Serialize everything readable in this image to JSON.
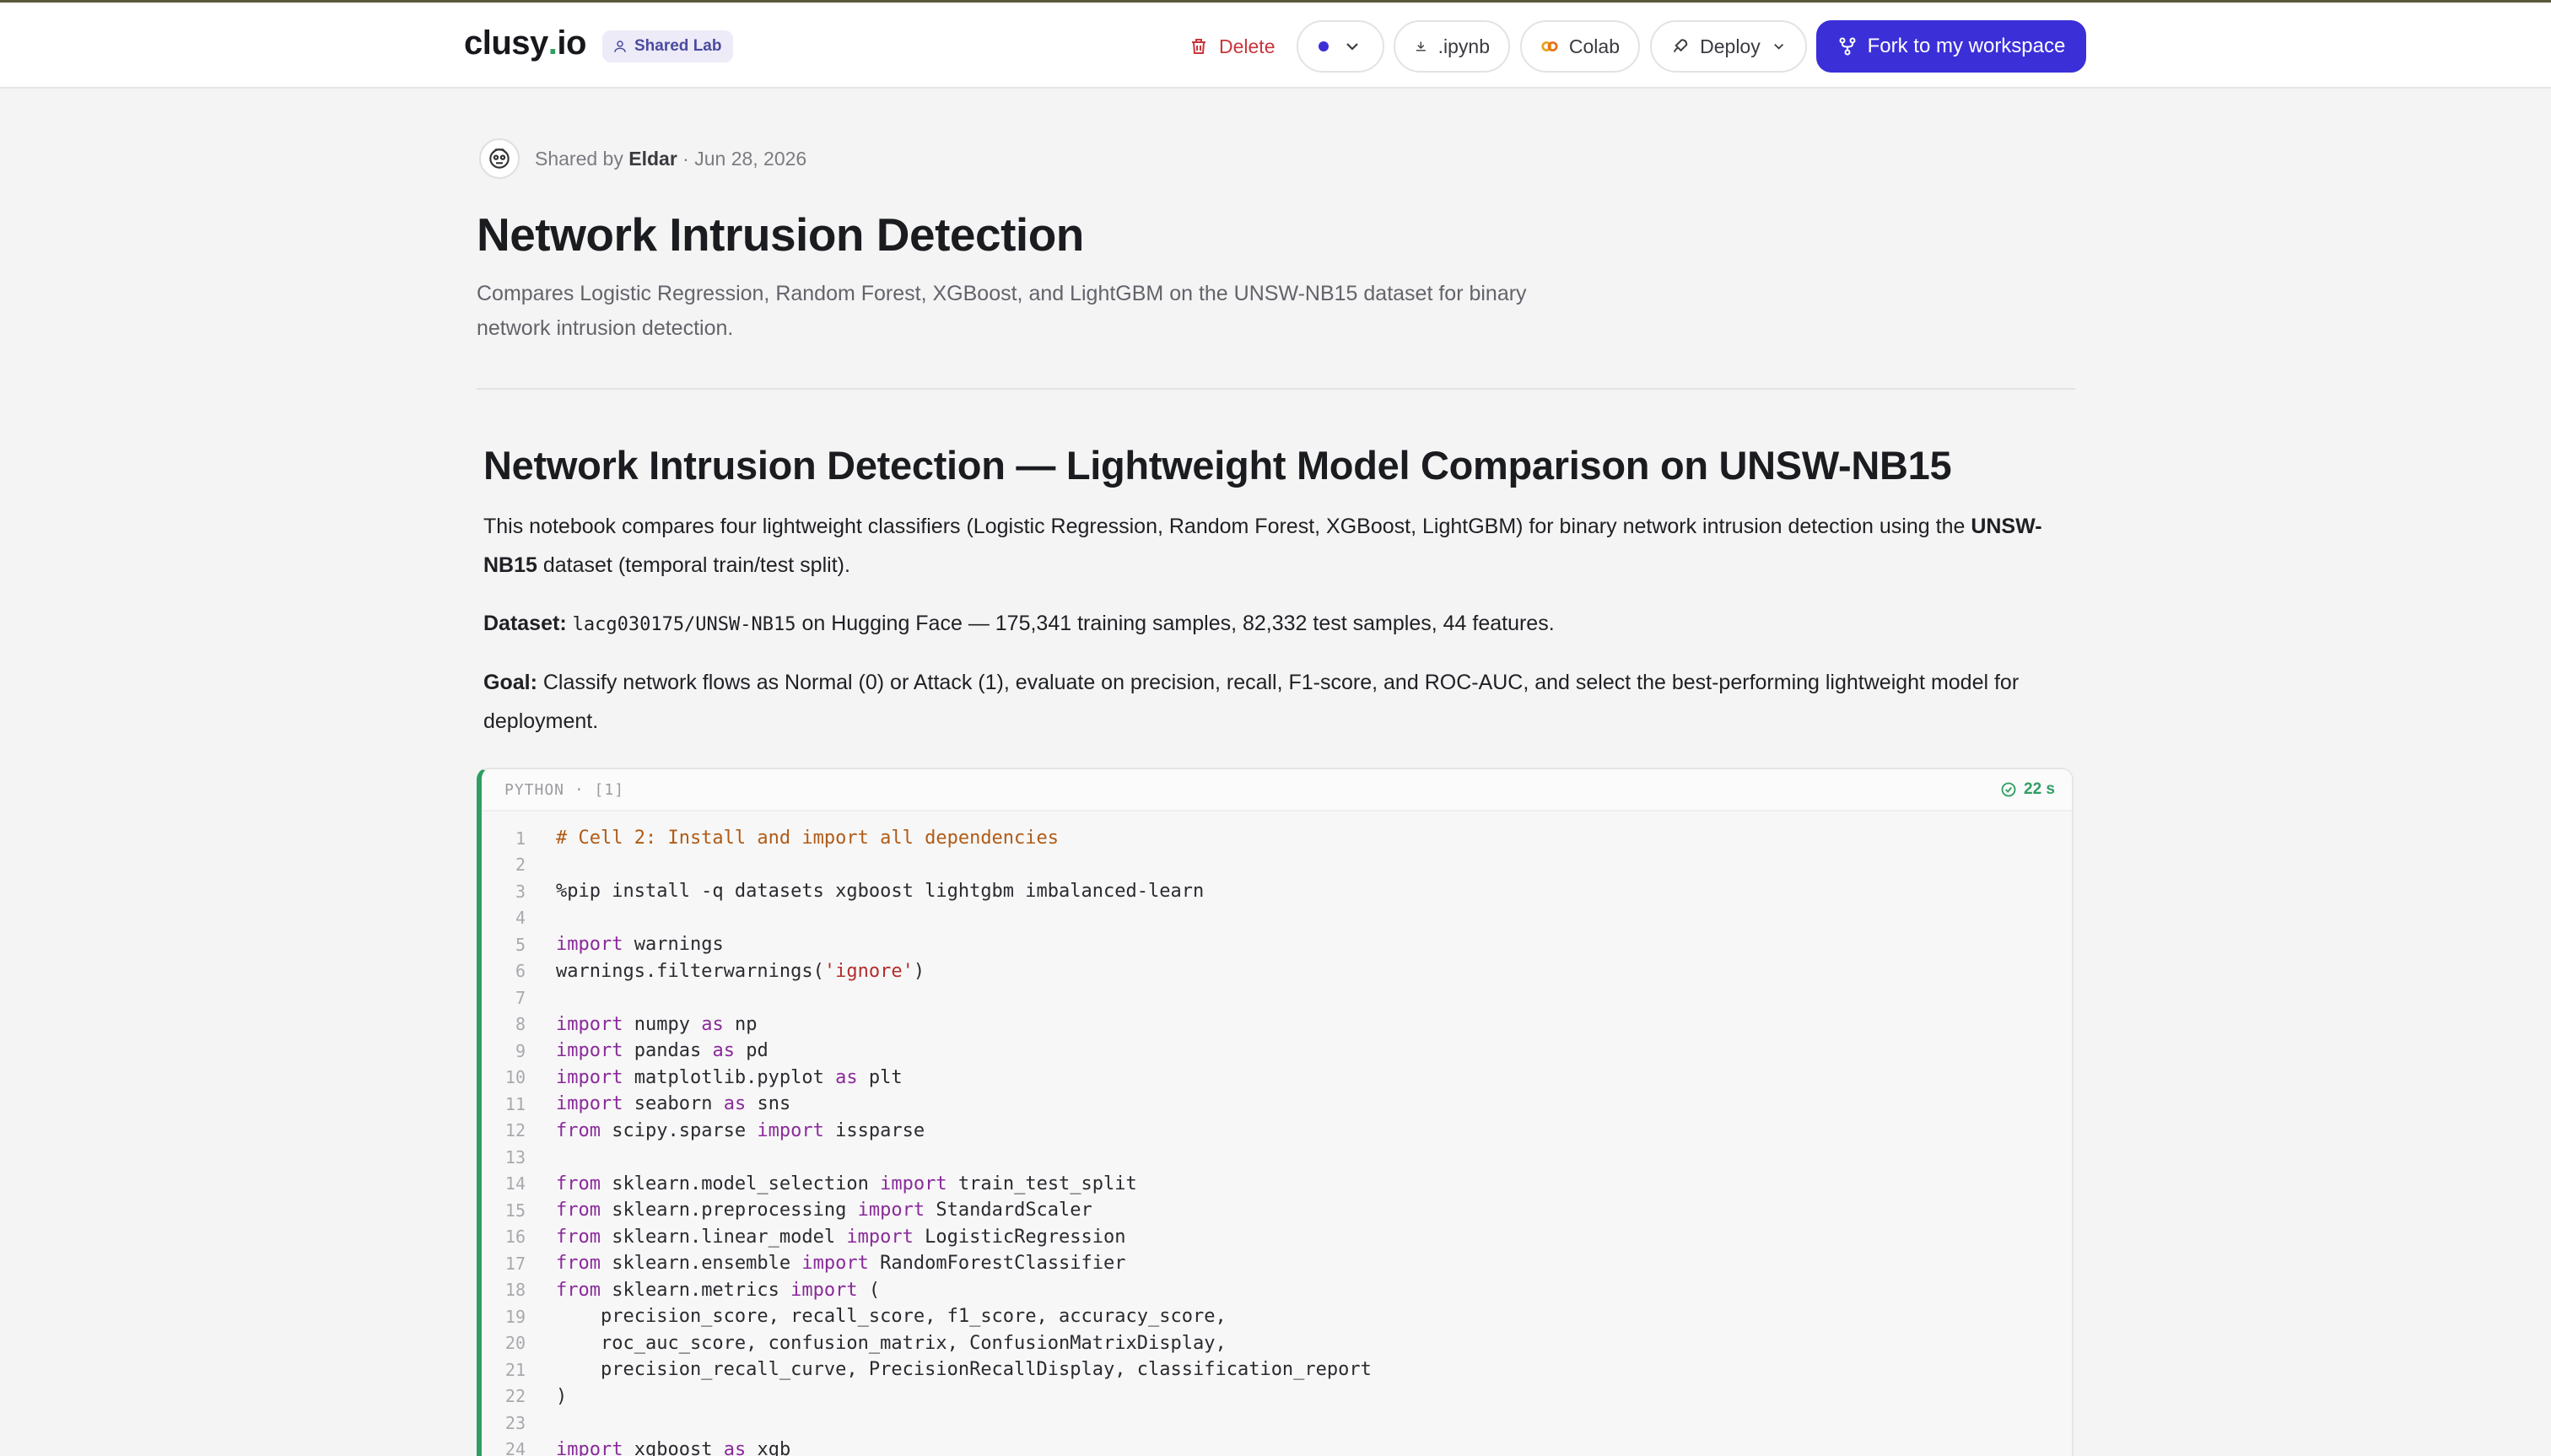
{
  "header": {
    "logo_main": "clusy",
    "logo_dot": ".",
    "logo_tld": "io",
    "shared_badge": "Shared Lab",
    "delete_label": "Delete",
    "ipynb_label": ".ipynb",
    "colab_label": "Colab",
    "deploy_label": "Deploy",
    "fork_label": "Fork to my workspace"
  },
  "meta": {
    "shared_by_prefix": "Shared by",
    "author": "Eldar",
    "date": "· Jun 28, 2026"
  },
  "page": {
    "title": "Network Intrusion Detection",
    "description": "Compares Logistic Regression, Random Forest, XGBoost, and LightGBM on the UNSW-NB15 dataset for binary network intrusion detection."
  },
  "notebook": {
    "heading": "Network Intrusion Detection — Lightweight Model Comparison on UNSW-NB15",
    "p1_text": "This notebook compares four lightweight classifiers (Logistic Regression, Random Forest, XGBoost, LightGBM) for binary network intrusion detection using the ",
    "p1_bold": "UNSW-NB15",
    "p1_tail": " dataset (temporal train/test split).",
    "p2_label": "Dataset:",
    "p2_code": "lacg030175/UNSW-NB15",
    "p2_text": " on Hugging Face — 175,341 training samples, 82,332 test samples, 44 features.",
    "p3_label": "Goal:",
    "p3_text": " Classify network flows as Normal (0) or Attack (1), evaluate on precision, recall, F1-score, and ROC-AUC, and select the best-performing lightweight model for deployment."
  },
  "cell": {
    "label": "PYTHON · [1]",
    "runtime": "22 s",
    "lines": [
      [
        [
          "com",
          "# Cell 2: Install and import all dependencies"
        ]
      ],
      [],
      [
        [
          "",
          "%pip install -q datasets xgboost lightgbm imbalanced-learn"
        ]
      ],
      [],
      [
        [
          "kw",
          "import"
        ],
        [
          "",
          " warnings"
        ]
      ],
      [
        [
          "",
          "warnings.filterwarnings("
        ],
        [
          "str",
          "'ignore'"
        ],
        [
          "",
          ")"
        ]
      ],
      [],
      [
        [
          "kw",
          "import"
        ],
        [
          "",
          " numpy "
        ],
        [
          "kw",
          "as"
        ],
        [
          "",
          " np"
        ]
      ],
      [
        [
          "kw",
          "import"
        ],
        [
          "",
          " pandas "
        ],
        [
          "kw",
          "as"
        ],
        [
          "",
          " pd"
        ]
      ],
      [
        [
          "kw",
          "import"
        ],
        [
          "",
          " matplotlib.pyplot "
        ],
        [
          "kw",
          "as"
        ],
        [
          "",
          " plt"
        ]
      ],
      [
        [
          "kw",
          "import"
        ],
        [
          "",
          " seaborn "
        ],
        [
          "kw",
          "as"
        ],
        [
          "",
          " sns"
        ]
      ],
      [
        [
          "kw",
          "from"
        ],
        [
          "",
          " scipy.sparse "
        ],
        [
          "kw",
          "import"
        ],
        [
          "",
          " issparse"
        ]
      ],
      [],
      [
        [
          "kw",
          "from"
        ],
        [
          "",
          " sklearn.model_selection "
        ],
        [
          "kw",
          "import"
        ],
        [
          "",
          " train_test_split"
        ]
      ],
      [
        [
          "kw",
          "from"
        ],
        [
          "",
          " sklearn.preprocessing "
        ],
        [
          "kw",
          "import"
        ],
        [
          "",
          " StandardScaler"
        ]
      ],
      [
        [
          "kw",
          "from"
        ],
        [
          "",
          " sklearn.linear_model "
        ],
        [
          "kw",
          "import"
        ],
        [
          "",
          " LogisticRegression"
        ]
      ],
      [
        [
          "kw",
          "from"
        ],
        [
          "",
          " sklearn.ensemble "
        ],
        [
          "kw",
          "import"
        ],
        [
          "",
          " RandomForestClassifier"
        ]
      ],
      [
        [
          "kw",
          "from"
        ],
        [
          "",
          " sklearn.metrics "
        ],
        [
          "kw",
          "import"
        ],
        [
          "",
          " ("
        ]
      ],
      [
        [
          "",
          "    precision_score, recall_score, f1_score, accuracy_score,"
        ]
      ],
      [
        [
          "",
          "    roc_auc_score, confusion_matrix, ConfusionMatrixDisplay,"
        ]
      ],
      [
        [
          "",
          "    precision_recall_curve, PrecisionRecallDisplay, classification_report"
        ]
      ],
      [
        [
          "",
          ")"
        ]
      ],
      [],
      [
        [
          "kw",
          "import"
        ],
        [
          "",
          " xgboost "
        ],
        [
          "kw",
          "as"
        ],
        [
          "",
          " xgb"
        ]
      ]
    ]
  },
  "colors": {
    "accent": "#3b2fd8",
    "success": "#2f9e62",
    "danger": "#c9353b"
  }
}
